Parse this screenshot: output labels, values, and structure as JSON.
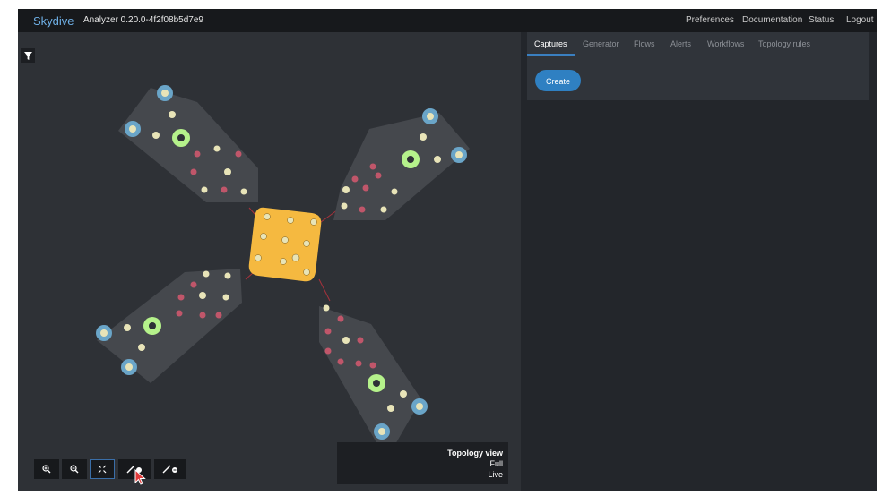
{
  "header": {
    "brand": "Skydive",
    "version": "Analyzer 0.20.0-4f2f08b5d7e9",
    "nav": [
      "Preferences",
      "Documentation",
      "Status",
      "Logout"
    ]
  },
  "panel": {
    "tabs": [
      "Captures",
      "Generator",
      "Flows",
      "Alerts",
      "Workflows",
      "Topology rules"
    ],
    "active_tab": "Captures",
    "create_label": "Create"
  },
  "topology_view": {
    "title": "Topology view",
    "filter": "Full",
    "mode": "Live"
  },
  "toolbar": {
    "buttons": [
      "zoom-in-icon",
      "zoom-out-icon",
      "fit-icon",
      "expand-icon",
      "collapse-icon"
    ]
  },
  "colors": {
    "accent": "#2f80c2",
    "center_group": "#f5b940",
    "node_green": "#b5f28b",
    "host_node": "#6aa5c8",
    "node_red": "#c0566a",
    "node_cream": "#e8e4b8",
    "group_fill": "#45484d"
  }
}
